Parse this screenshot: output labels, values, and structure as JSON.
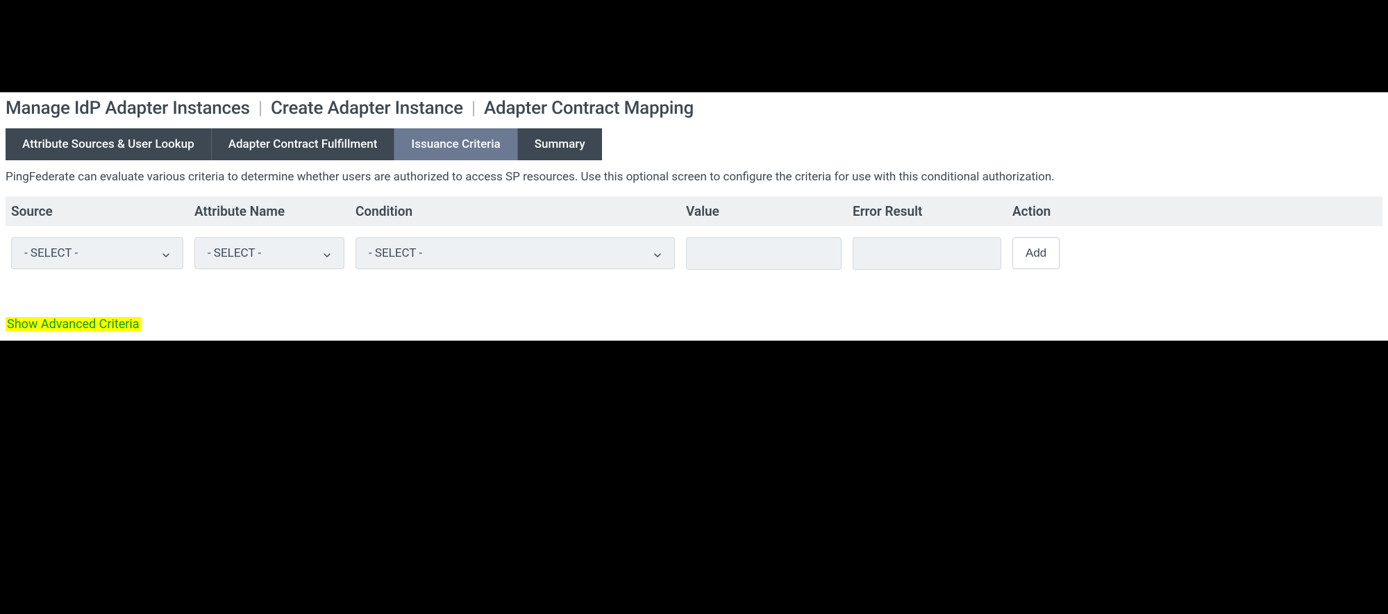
{
  "breadcrumb": {
    "items": [
      "Manage IdP Adapter Instances",
      "Create Adapter Instance",
      "Adapter Contract Mapping"
    ]
  },
  "tabs": [
    {
      "label": "Attribute Sources & User Lookup",
      "active": false
    },
    {
      "label": "Adapter Contract Fulfillment",
      "active": false
    },
    {
      "label": "Issuance Criteria",
      "active": true
    },
    {
      "label": "Summary",
      "active": false
    }
  ],
  "description": "PingFederate can evaluate various criteria to determine whether users are authorized to access SP resources. Use this optional screen to configure the criteria for use with this conditional authorization.",
  "columns": {
    "source": "Source",
    "attributeName": "Attribute Name",
    "condition": "Condition",
    "value": "Value",
    "errorResult": "Error Result",
    "action": "Action"
  },
  "row": {
    "sourceSelect": "- SELECT -",
    "attrSelect": "- SELECT -",
    "conditionSelect": "- SELECT -",
    "valueInput": "",
    "errorInput": "",
    "addButton": "Add"
  },
  "advancedLink": "Show Advanced Criteria"
}
